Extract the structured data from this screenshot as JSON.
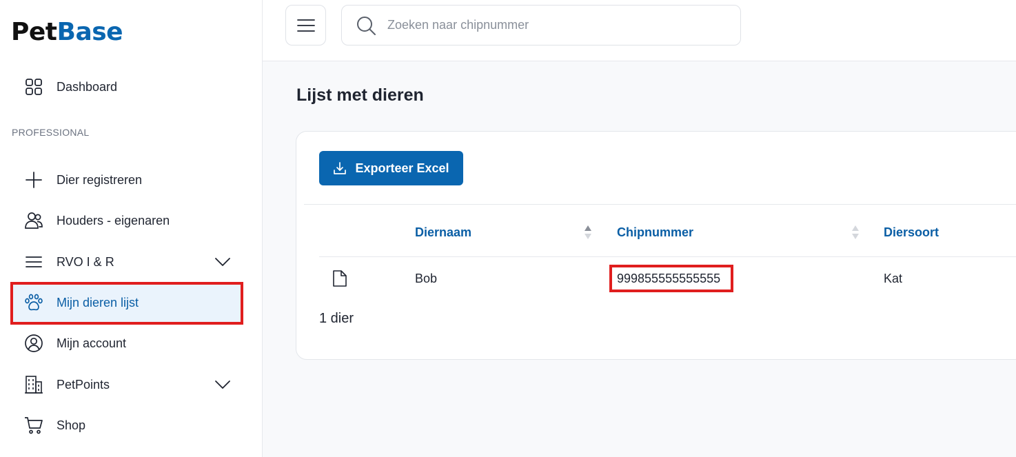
{
  "brand": {
    "part1": "Pet",
    "part2": "Base"
  },
  "sidebar": {
    "dashboard": "Dashboard",
    "section": "PROFESSIONAL",
    "items": [
      {
        "label": "Dier registreren",
        "icon": "plus-icon"
      },
      {
        "label": "Houders - eigenaren",
        "icon": "users-icon"
      },
      {
        "label": "RVO I & R",
        "icon": "menu-lines-icon",
        "has_submenu": true
      },
      {
        "label": "Mijn dieren lijst",
        "icon": "paw-icon",
        "active": true
      },
      {
        "label": "Mijn account",
        "icon": "user-circle-icon"
      },
      {
        "label": "PetPoints",
        "icon": "building-icon",
        "has_submenu": true
      },
      {
        "label": "Shop",
        "icon": "cart-icon"
      }
    ]
  },
  "search": {
    "placeholder": "Zoeken naar chipnummer",
    "value": ""
  },
  "main": {
    "title": "Lijst met dieren",
    "export_label": "Exporteer Excel",
    "columns": [
      "Diernaam",
      "Chipnummer",
      "Diersoort"
    ],
    "rows": [
      {
        "diernaam": "Bob",
        "chipnummer": "999855555555555",
        "diersoort": "Kat"
      }
    ],
    "count_label": "1 dier"
  },
  "colors": {
    "brand": "#0a66b0",
    "highlight": "#e01e1e",
    "active_bg": "#eaf3fc"
  }
}
